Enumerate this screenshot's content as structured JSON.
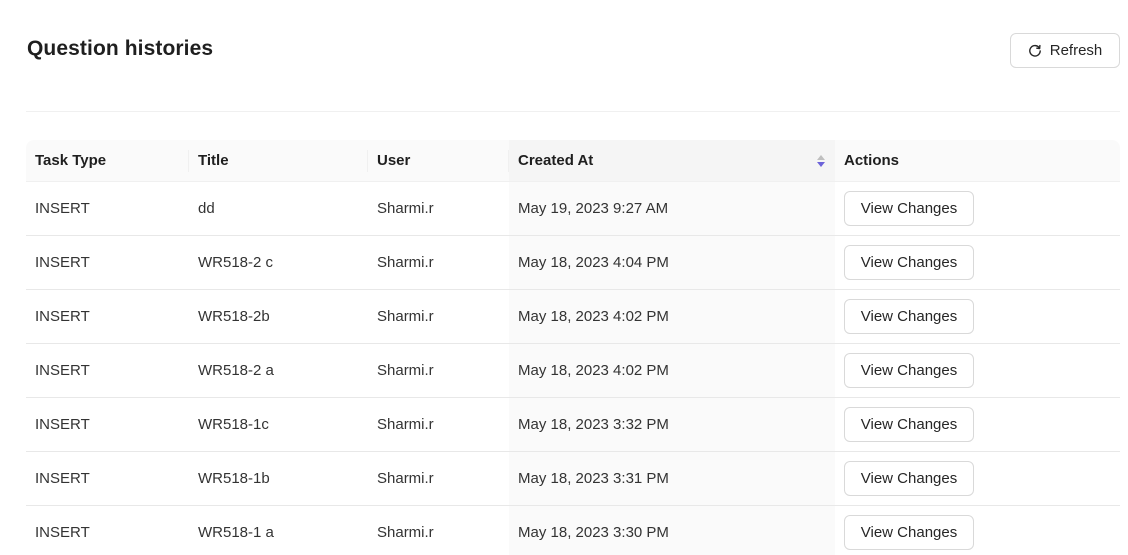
{
  "header": {
    "title": "Question histories",
    "refresh_label": "Refresh",
    "refresh_icon": "reload-icon"
  },
  "table": {
    "columns": [
      "Task Type",
      "Title",
      "User",
      "Created At",
      "Actions"
    ],
    "sorted_column": "Created At",
    "sort_order": "descending",
    "rows": [
      {
        "task_type": "INSERT",
        "title": "dd",
        "user": "Sharmi.r",
        "created_at": "May 19, 2023 9:27 AM",
        "action_label": "View Changes"
      },
      {
        "task_type": "INSERT",
        "title": "WR518-2 c",
        "user": "Sharmi.r",
        "created_at": "May 18, 2023 4:04 PM",
        "action_label": "View Changes"
      },
      {
        "task_type": "INSERT",
        "title": "WR518-2b",
        "user": "Sharmi.r",
        "created_at": "May 18, 2023 4:02 PM",
        "action_label": "View Changes"
      },
      {
        "task_type": "INSERT",
        "title": "WR518-2 a",
        "user": "Sharmi.r",
        "created_at": "May 18, 2023 4:02 PM",
        "action_label": "View Changes"
      },
      {
        "task_type": "INSERT",
        "title": "WR518-1c",
        "user": "Sharmi.r",
        "created_at": "May 18, 2023 3:32 PM",
        "action_label": "View Changes"
      },
      {
        "task_type": "INSERT",
        "title": "WR518-1b",
        "user": "Sharmi.r",
        "created_at": "May 18, 2023 3:31 PM",
        "action_label": "View Changes"
      },
      {
        "task_type": "INSERT",
        "title": "WR518-1 a",
        "user": "Sharmi.r",
        "created_at": "May 18, 2023 3:30 PM",
        "action_label": "View Changes"
      }
    ]
  },
  "colors": {
    "sort_active": "#6c63d9",
    "header_bg": "#fafafa",
    "border": "#e8e8e8"
  }
}
